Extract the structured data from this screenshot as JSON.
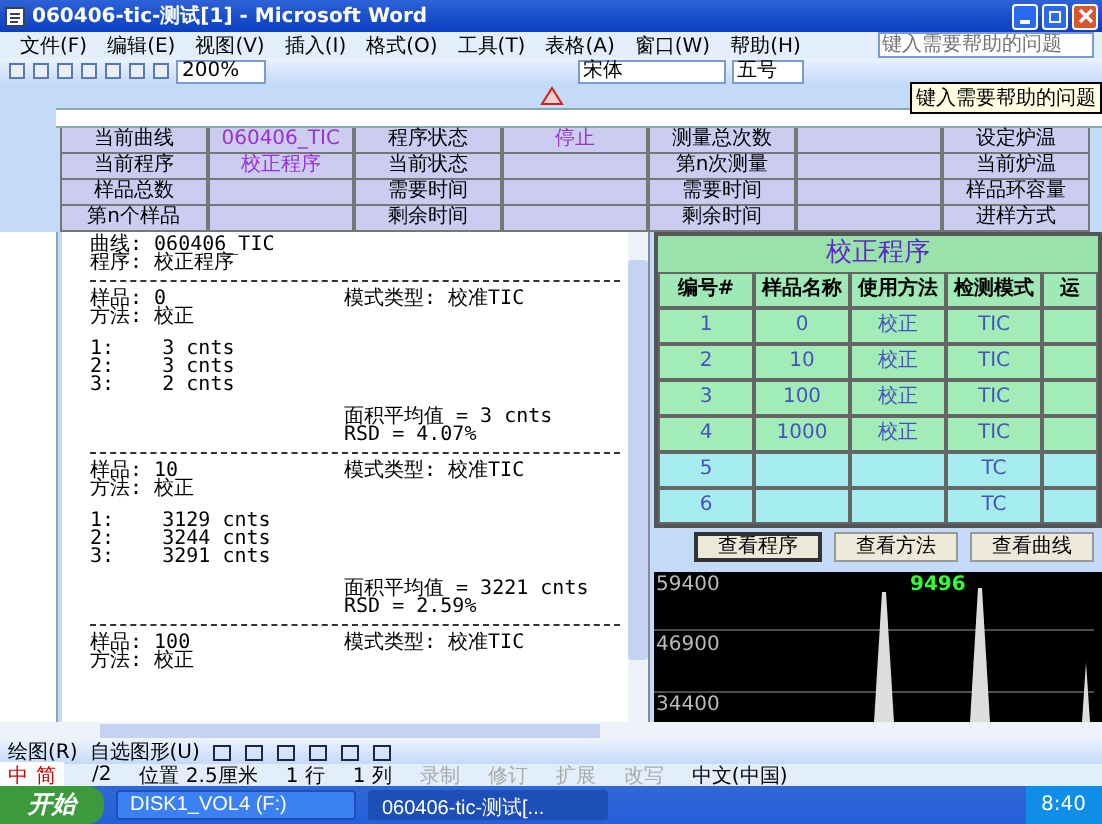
{
  "window": {
    "title": "060406-tic-测试[1] - Microsoft Word"
  },
  "menu": [
    "文件(F)",
    "编辑(E)",
    "视图(V)",
    "插入(I)",
    "格式(O)",
    "工具(T)",
    "表格(A)",
    "窗口(W)",
    "帮助(H)"
  ],
  "help_box": {
    "placeholder": "键入需要帮助的问题"
  },
  "toolbar": {
    "zoom": "200%",
    "font": "宋体",
    "size": "五号"
  },
  "tooltip": "键入需要帮助的问题",
  "status_table": {
    "rows": [
      [
        "当前曲线",
        "060406_TIC",
        "程序状态",
        "停止",
        "测量总次数",
        "",
        "设定炉温"
      ],
      [
        "当前程序",
        "校正程序",
        "当前状态",
        "",
        "第n次测量",
        "",
        "当前炉温"
      ],
      [
        "样品总数",
        "",
        "需要时间",
        "",
        "需要时间",
        "",
        "样品环容量"
      ],
      [
        "第n个样品",
        "",
        "剩余时间",
        "",
        "剩余时间",
        "",
        "进样方式"
      ]
    ]
  },
  "document": {
    "header": [
      "曲线: 060406_TIC",
      "程序: 校正程序"
    ],
    "samples": [
      {
        "sample": "样品: 0",
        "mode": "模式类型: 校准TIC",
        "method": "方法: 校正",
        "readings": [
          "1:    3 cnts",
          "2:    3 cnts",
          "3:    2 cnts"
        ],
        "average": "面积平均值 = 3 cnts",
        "rsd": "RSD = 4.07%"
      },
      {
        "sample": "样品: 10",
        "mode": "模式类型: 校准TIC",
        "method": "方法: 校正",
        "readings": [
          "1:    3129 cnts",
          "2:    3244 cnts",
          "3:    3291 cnts"
        ],
        "average": "面积平均值 = 3221 cnts",
        "rsd": "RSD = 2.59%"
      },
      {
        "sample": "样品: 100",
        "mode": "模式类型: 校准TIC",
        "method": "方法: 校正"
      }
    ]
  },
  "program_table": {
    "title": "校正程序",
    "columns": [
      "编号#",
      "样品名称",
      "使用方法",
      "检测模式",
      "运"
    ],
    "rows": [
      {
        "cells": [
          "1",
          "0",
          "校正",
          "TIC"
        ],
        "filled": true
      },
      {
        "cells": [
          "2",
          "10",
          "校正",
          "TIC"
        ],
        "filled": true
      },
      {
        "cells": [
          "3",
          "100",
          "校正",
          "TIC"
        ],
        "filled": true
      },
      {
        "cells": [
          "4",
          "1000",
          "校正",
          "TIC"
        ],
        "filled": true
      },
      {
        "cells": [
          "5",
          "",
          "",
          "TC"
        ],
        "filled": false
      },
      {
        "cells": [
          "6",
          "",
          "",
          "TC"
        ],
        "filled": false
      }
    ]
  },
  "view_buttons": [
    {
      "label": "查看程序",
      "selected": true
    },
    {
      "label": "查看方法",
      "selected": false
    },
    {
      "label": "查看曲线",
      "selected": false
    }
  ],
  "signal": {
    "y_labels": [
      "59400",
      "46900",
      "34400"
    ],
    "peak_label": "9496"
  },
  "drawing_toolbar": {
    "draw": "绘图(R)",
    "autoshapes": "自选图形(U)"
  },
  "status_bar": {
    "ime": [
      "中",
      "简"
    ],
    "page": "/2",
    "position": "位置 2.5厘米",
    "line": "1 行",
    "column": "1 列",
    "modes": [
      {
        "label": "录制",
        "on": false
      },
      {
        "label": "修订",
        "on": false
      },
      {
        "label": "扩展",
        "on": false
      },
      {
        "label": "改写",
        "on": false
      }
    ],
    "language": "中文(中国)"
  },
  "taskbar": {
    "start": "开始",
    "tasks": [
      {
        "label": "DISK1_VOL4 (F:)",
        "selected": false
      },
      {
        "label": "060406-tic-测试[...",
        "selected": true
      }
    ],
    "clock": "8:40"
  }
}
